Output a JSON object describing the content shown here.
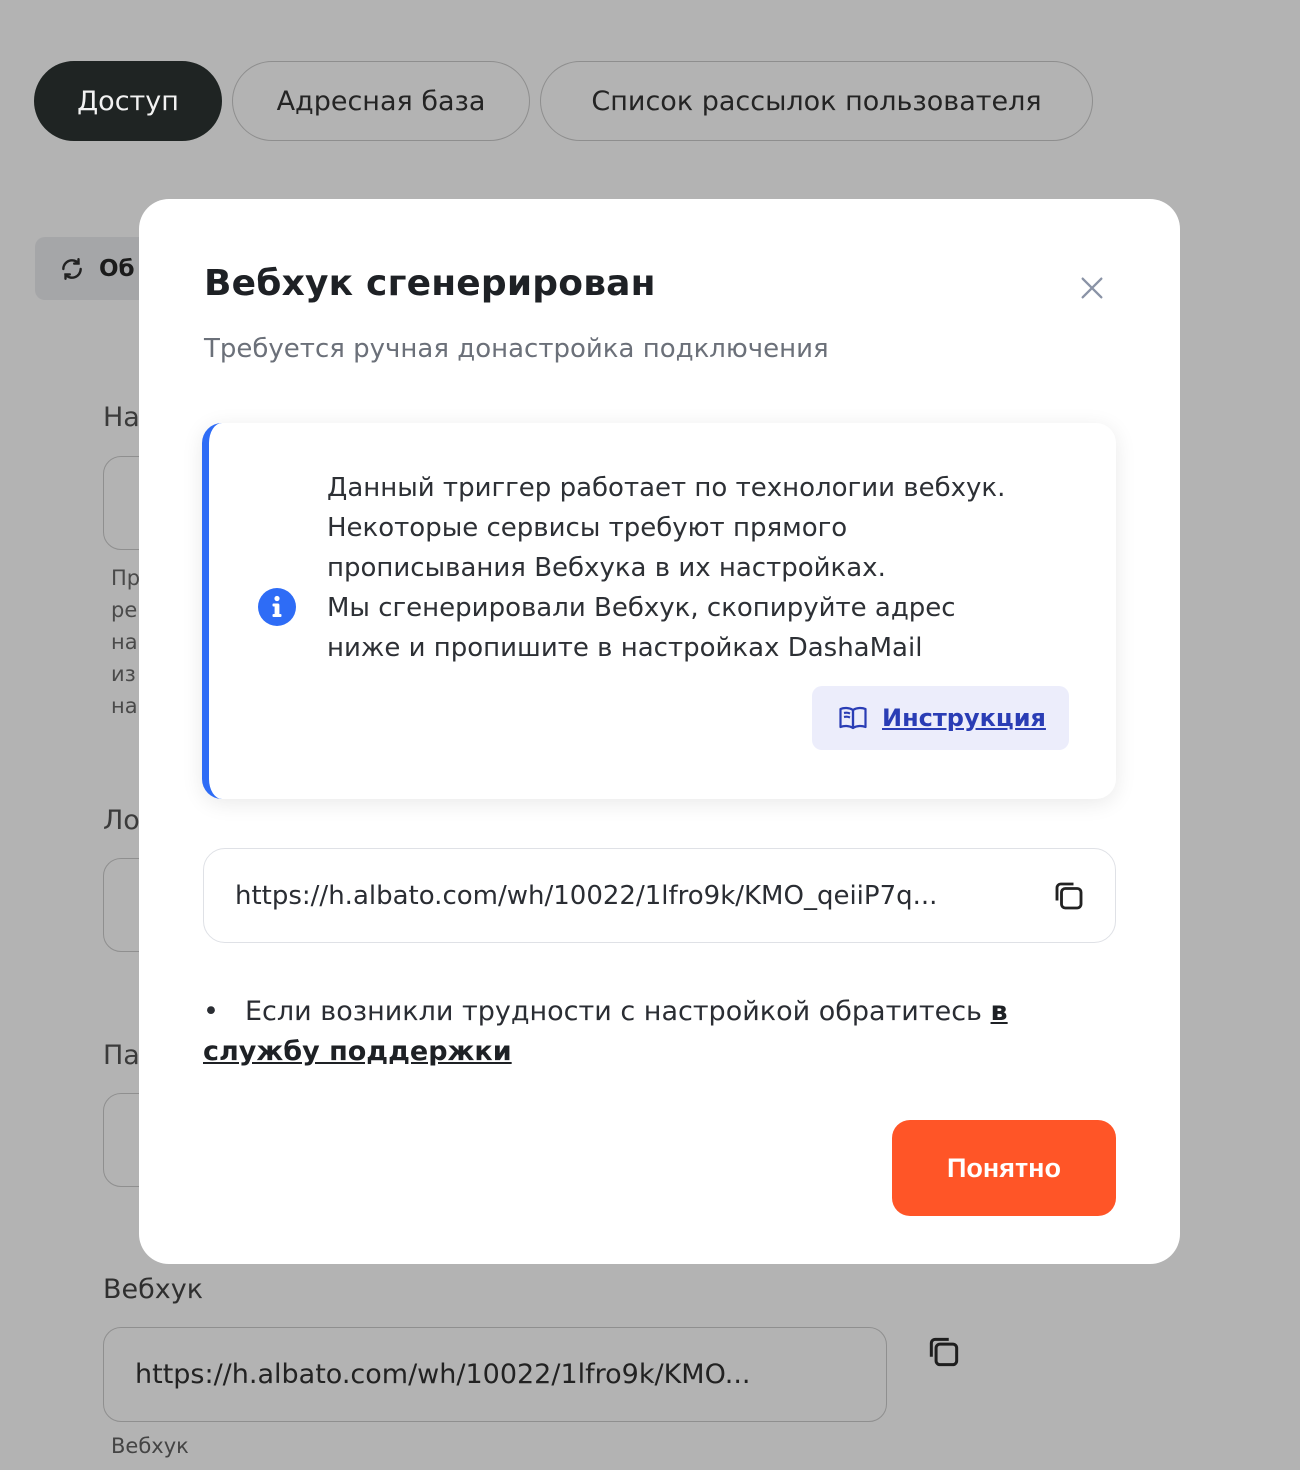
{
  "tabs": [
    {
      "label": "Доступ",
      "active": true
    },
    {
      "label": "Адресная база",
      "active": false
    },
    {
      "label": "Список рассылок пользователя",
      "active": false
    }
  ],
  "background": {
    "refresh_button_label": "Об",
    "labels": [
      "На",
      "Ло",
      "Па"
    ],
    "hint_lines": [
      "Пр",
      "ре",
      "на",
      "из",
      "на"
    ],
    "webhook_label": "Вебхук",
    "webhook_value": "https://h.albato.com/wh/10022/1lfro9k/KMO...",
    "webhook_hint": "Вебхук"
  },
  "modal": {
    "title": "Вебхук сгенерирован",
    "subtitle": "Требуется ручная донастройка подключения",
    "info_lines": [
      "Данный триггер работает по технологии вебхук.",
      "Некоторые сервисы требуют прямого",
      "прописывания Вебхука в их настройках.",
      "Мы сгенерировали Вебхук, скопируйте адрес",
      "ниже и пропишите в настройках DashaMail"
    ],
    "instruction_label": "Инструкция",
    "webhook_url": "https://h.albato.com/wh/10022/1lfro9k/KMO_qeiiP7q...",
    "support_text": "Если возникли трудности с настройкой обратитесь ",
    "support_link": "в службу поддержки",
    "ok_label": "Понятно"
  },
  "colors": {
    "overlay_background": "#b3b3b3",
    "accent_blue": "#2e6cf6",
    "primary_button": "#ff5527",
    "active_tab": "#1f2423"
  }
}
